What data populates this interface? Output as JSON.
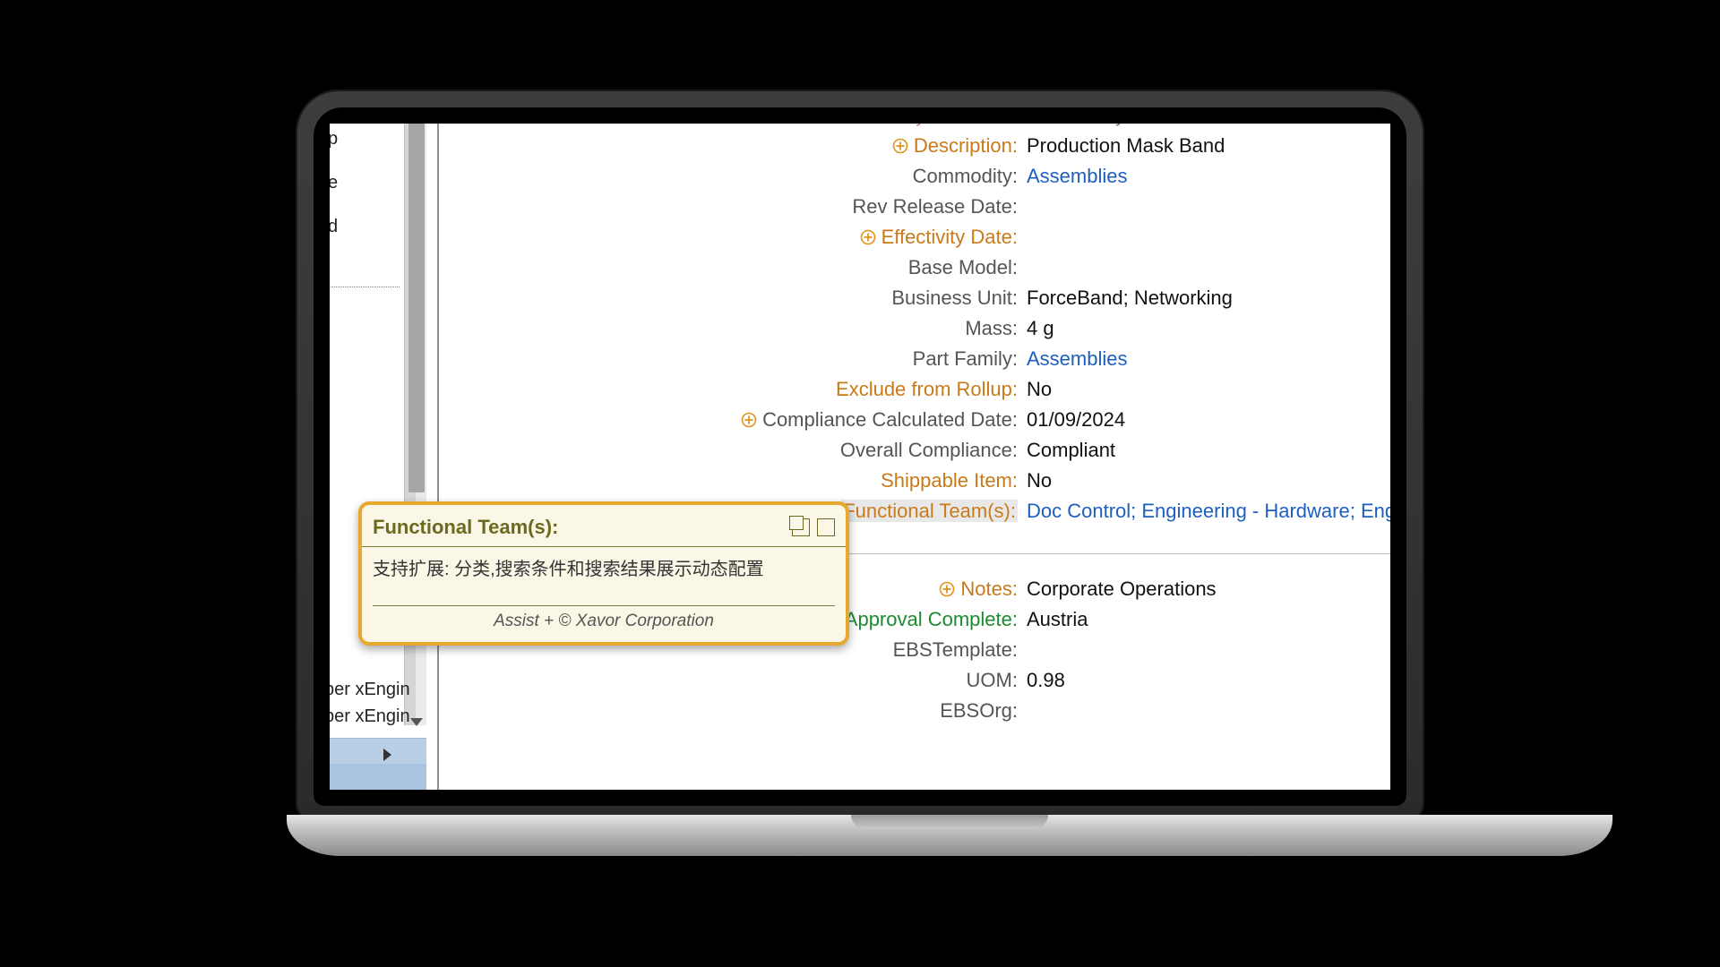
{
  "sidebar": {
    "items": [
      "p",
      "",
      "",
      "e",
      "",
      "",
      "d"
    ],
    "engine_line_1": "ber xEngin",
    "engine_line_2": "ber xEngin"
  },
  "fields": [
    {
      "id": "lifecycle_phase",
      "label": "Lifecycle Phase:",
      "value": "Preliminary",
      "style": "maroon",
      "icon": false,
      "link": false,
      "cutoff": true
    },
    {
      "id": "description",
      "label": "Description:",
      "value": "Production Mask Band",
      "style": "orange",
      "icon": true,
      "link": false
    },
    {
      "id": "commodity",
      "label": "Commodity:",
      "value": "Assemblies",
      "style": "grey",
      "icon": false,
      "link": true
    },
    {
      "id": "rev_release_date",
      "label": "Rev Release Date:",
      "value": "",
      "style": "grey",
      "icon": false,
      "link": false
    },
    {
      "id": "effectivity_date",
      "label": "Effectivity Date:",
      "value": "",
      "style": "orange",
      "icon": true,
      "link": false
    },
    {
      "id": "base_model",
      "label": "Base Model:",
      "value": "",
      "style": "grey",
      "icon": false,
      "link": false
    },
    {
      "id": "business_unit",
      "label": "Business Unit:",
      "value": "ForceBand; Networking",
      "style": "grey",
      "icon": false,
      "link": false
    },
    {
      "id": "mass",
      "label": "Mass:",
      "value": "4 g",
      "style": "grey",
      "icon": false,
      "link": false
    },
    {
      "id": "part_family",
      "label": "Part Family:",
      "value": "Assemblies",
      "style": "grey",
      "icon": false,
      "link": true
    },
    {
      "id": "exclude_from_rollup",
      "label": "Exclude from Rollup:",
      "value": "No",
      "style": "orange",
      "icon": false,
      "link": false
    },
    {
      "id": "compliance_calculated_date",
      "label": "Compliance Calculated Date:",
      "value": "01/09/2024",
      "style": "grey",
      "icon": true,
      "link": false
    },
    {
      "id": "overall_compliance",
      "label": "Overall Compliance:",
      "value": "Compliant",
      "style": "grey",
      "icon": false,
      "link": false
    },
    {
      "id": "shippable_item",
      "label": "Shippable Item:",
      "value": "No",
      "style": "orange",
      "icon": false,
      "link": false
    },
    {
      "id": "functional_teams",
      "label": "Functional Team(s):",
      "value": "Doc Control; Engineering - Hardware; Enginee",
      "style": "orange",
      "icon": true,
      "link": true,
      "highlight": true
    }
  ],
  "section2": [
    {
      "id": "notes",
      "label": "Notes:",
      "value": "Corporate Operations",
      "style": "orange",
      "icon": true,
      "link": false
    },
    {
      "id": "market_approval_complete",
      "label": "Market Approval Complete:",
      "value": "Austria",
      "style": "green",
      "icon": true,
      "link": false
    },
    {
      "id": "ebs_template",
      "label": "EBSTemplate:",
      "value": "",
      "style": "grey",
      "icon": false,
      "link": false
    },
    {
      "id": "uom",
      "label": "UOM:",
      "value": "0.98",
      "style": "grey",
      "icon": false,
      "link": false
    },
    {
      "id": "ebs_org",
      "label": "EBSOrg:",
      "value": "",
      "style": "grey",
      "icon": false,
      "link": false
    }
  ],
  "tooltip": {
    "title": "Functional Team(s):",
    "body": "支持扩展: 分类,搜索条件和搜索结果展示动态配置",
    "footer": "Assist + © Xavor Corporation"
  }
}
